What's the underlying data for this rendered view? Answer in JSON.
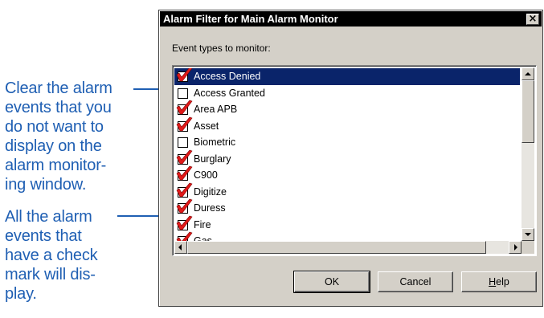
{
  "callouts": {
    "clear_text": "Clear the alarm\nevents that you\ndo not want to\ndisplay on the\nalarm monitor-\ning window.",
    "check_text": "All the alarm\nevents that\nhave a check\nmark will dis-\nplay."
  },
  "dialog": {
    "title": "Alarm Filter for Main Alarm Monitor",
    "close_glyph": "×",
    "group_label": "Event types to monitor:",
    "items": [
      {
        "label": "Access Denied",
        "checked": true,
        "selected": true
      },
      {
        "label": "Access Granted",
        "checked": false,
        "selected": false
      },
      {
        "label": "Area APB",
        "checked": true,
        "selected": false
      },
      {
        "label": "Asset",
        "checked": true,
        "selected": false
      },
      {
        "label": "Biometric",
        "checked": false,
        "selected": false
      },
      {
        "label": "Burglary",
        "checked": true,
        "selected": false
      },
      {
        "label": "C900",
        "checked": true,
        "selected": false
      },
      {
        "label": "Digitize",
        "checked": true,
        "selected": false
      },
      {
        "label": "Duress",
        "checked": true,
        "selected": false
      },
      {
        "label": "Fire",
        "checked": true,
        "selected": false
      },
      {
        "label": "Gas",
        "checked": true,
        "selected": false
      }
    ],
    "buttons": {
      "ok": "OK",
      "cancel": "Cancel",
      "help": "Help"
    }
  },
  "colors": {
    "callout": "#1f5fb3",
    "tick": "#e01919",
    "selection": "#0a246a",
    "face": "#d4d0c8"
  }
}
